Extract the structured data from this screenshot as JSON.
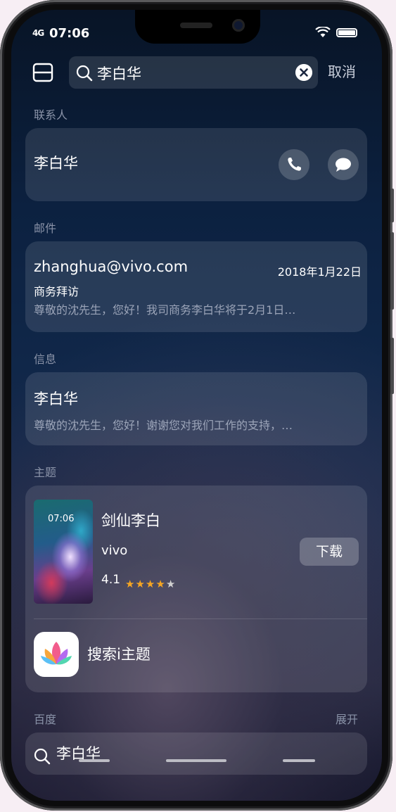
{
  "status_bar": {
    "time": "07:06",
    "signal": "4G"
  },
  "search": {
    "value": "李白华",
    "cancel_label": "取消"
  },
  "contacts": {
    "section_label": "联系人",
    "name": "李白华"
  },
  "email": {
    "section_label": "邮件",
    "address": "zhanghua@vivo.com",
    "date": "2018年1月22日",
    "subject": "商务拜访",
    "preview": "尊敬的沈先生，您好！我司商务李白华将于2月1日…"
  },
  "messages": {
    "section_label": "信息",
    "sender": "李白华",
    "preview": "尊敬的沈先生，您好！谢谢您对我们工作的支持，…"
  },
  "themes": {
    "section_label": "主题",
    "title": "剑仙李白",
    "author": "vivo",
    "rating": "4.1",
    "rating_value": 4.1,
    "rating_max": 5,
    "download_label": "下载",
    "thumbnail_time": "07:06",
    "store_label": "搜索i主题"
  },
  "baidu": {
    "section_label": "百度",
    "expand_label": "展开",
    "query": "李白华"
  },
  "colors": {
    "star_on": "#f5a623",
    "star_off": "#d0d0d0"
  }
}
